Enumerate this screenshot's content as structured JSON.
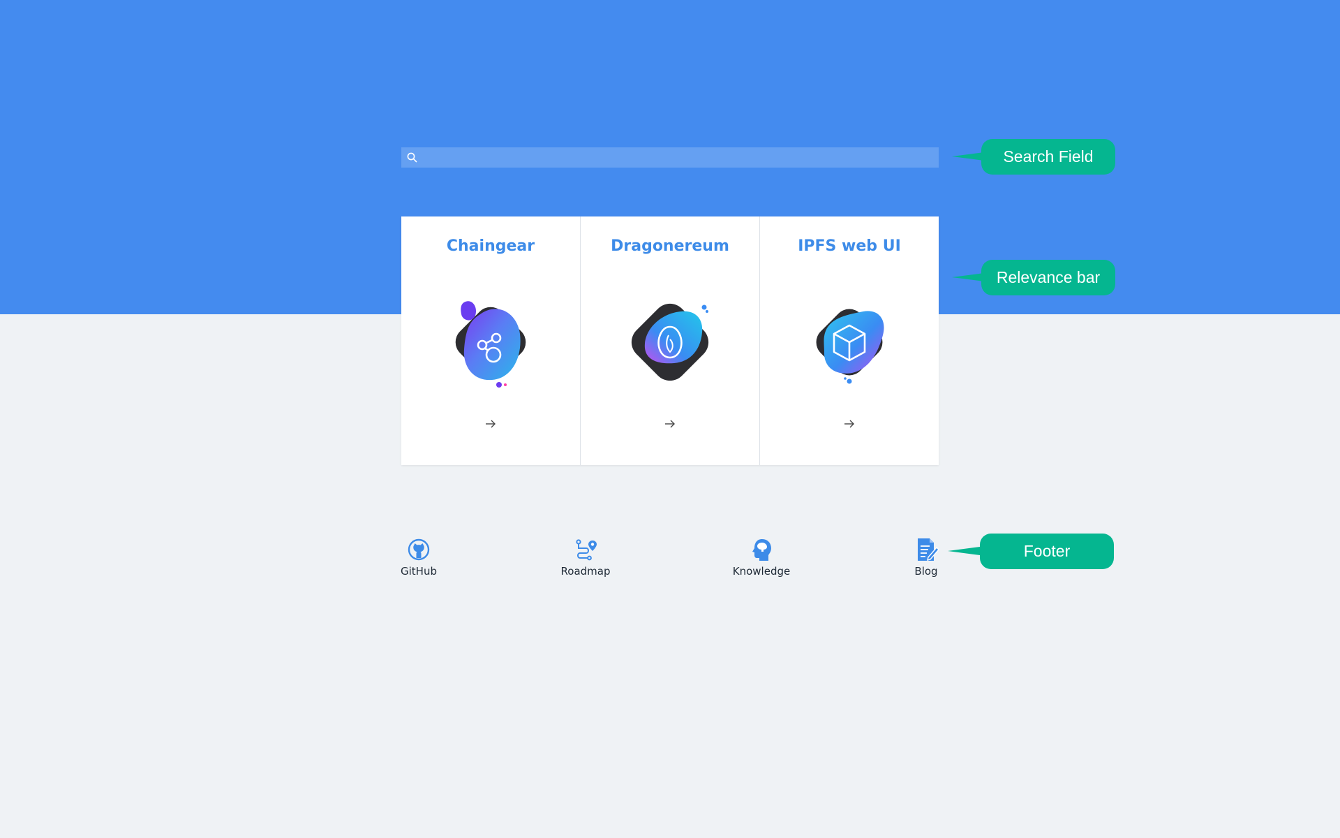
{
  "search": {
    "placeholder": "",
    "value": ""
  },
  "cards": [
    {
      "title": "Chaingear",
      "icon": "graph-nodes-icon"
    },
    {
      "title": "Dragonereum",
      "icon": "dragon-egg-icon"
    },
    {
      "title": "IPFS web UI",
      "icon": "cube-icon"
    }
  ],
  "footer": {
    "links": [
      {
        "label": "GitHub",
        "icon": "github-icon"
      },
      {
        "label": "Roadmap",
        "icon": "roadmap-icon"
      },
      {
        "label": "Knowledge",
        "icon": "knowledge-head-icon"
      },
      {
        "label": "Blog",
        "icon": "blog-doc-icon"
      }
    ]
  },
  "annotations": {
    "search_field": "Search Field",
    "relevance_bar": "Relevance bar",
    "footer": "Footer"
  },
  "colors": {
    "hero": "#448bef",
    "background": "#eff2f5",
    "accent": "#3d8be8",
    "callout": "#05b690"
  }
}
